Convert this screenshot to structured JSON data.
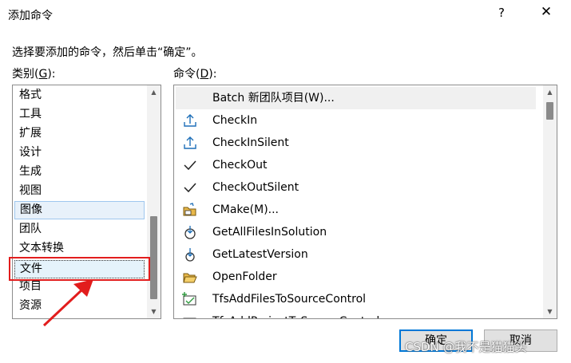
{
  "dialog": {
    "title": "添加命令",
    "help_label": "?",
    "close_label": "✕",
    "instruction": "选择要添加的命令，然后单击“确定”。"
  },
  "categories": {
    "label_main": "类别(",
    "label_key": "G",
    "label_end": "):",
    "items": [
      "格式",
      "工具",
      "扩展",
      "设计",
      "生成",
      "视图",
      "图像",
      "团队",
      "文本转换",
      "文件",
      "项目",
      "资源"
    ],
    "selected": "图像",
    "focused": "文件"
  },
  "commands": {
    "label_main": "命令(",
    "label_key": "D",
    "label_end": "):",
    "items": [
      {
        "label": "Batch 新团队项目(W)...",
        "icon": "none"
      },
      {
        "label": "CheckIn",
        "icon": "checkin-icon"
      },
      {
        "label": "CheckInSilent",
        "icon": "checkin-silent-icon"
      },
      {
        "label": "CheckOut",
        "icon": "checkmark-icon"
      },
      {
        "label": "CheckOutSilent",
        "icon": "checkmark-icon"
      },
      {
        "label": "CMake(M)...",
        "icon": "cmake-folder-icon"
      },
      {
        "label": "GetAllFilesInSolution",
        "icon": "get-all-files-icon"
      },
      {
        "label": "GetLatestVersion",
        "icon": "get-latest-icon"
      },
      {
        "label": "OpenFolder",
        "icon": "open-folder-icon"
      },
      {
        "label": "TfsAddFilesToSourceControl",
        "icon": "tfs-add-icon"
      },
      {
        "label": "TfsAddProjectToSourceControl",
        "icon": "tfs-add-project-icon"
      }
    ]
  },
  "buttons": {
    "ok": "确定",
    "cancel": "取消"
  },
  "annotation": {
    "box_color": "#e21d1d",
    "arrow_color": "#e21d1d"
  },
  "watermark": "CSDN @我不是猫猫头"
}
